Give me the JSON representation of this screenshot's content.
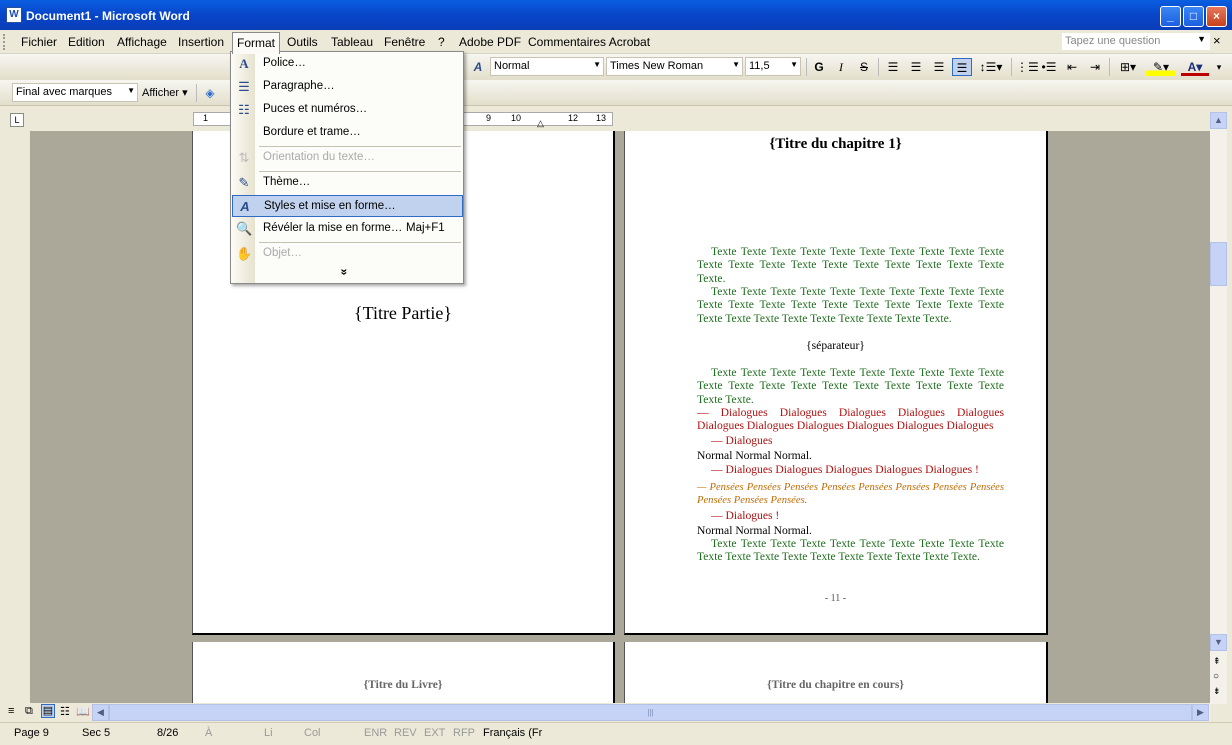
{
  "window": {
    "title": "Document1 - Microsoft Word",
    "app_icon": "W"
  },
  "menubar": {
    "items": [
      "Fichier",
      "Edition",
      "Affichage",
      "Insertion",
      "Format",
      "Outils",
      "Tableau",
      "Fenêtre",
      "?",
      "Adobe PDF",
      "Commentaires Acrobat"
    ],
    "active": "Format",
    "question_placeholder": "Tapez une question"
  },
  "format_menu": {
    "items": [
      {
        "label": "Police…",
        "icon": "font-icon",
        "enabled": true
      },
      {
        "label": "Paragraphe…",
        "icon": "paragraph-icon",
        "enabled": true
      },
      {
        "label": "Puces et numéros…",
        "icon": "bullets-icon",
        "enabled": true
      },
      {
        "label": "Bordure et trame…",
        "icon": "",
        "enabled": true
      },
      {
        "label": "Orientation du texte…",
        "icon": "text-direction-icon",
        "enabled": false
      },
      {
        "label": "Thème…",
        "icon": "theme-icon",
        "enabled": true
      },
      {
        "label": "Styles et mise en forme…",
        "icon": "styles-icon",
        "enabled": true,
        "highlighted": true
      },
      {
        "label": "Révéler la mise en forme…",
        "icon": "reveal-formatting-icon",
        "enabled": true,
        "shortcut": "Maj+F1"
      },
      {
        "label": "Objet…",
        "icon": "object-icon",
        "enabled": false
      }
    ],
    "expand_glyph": "»"
  },
  "toolbar": {
    "style": "Normal",
    "font": "Times New Roman",
    "size": "11,5",
    "bold": "G",
    "italic": "I",
    "strike": "S"
  },
  "reviewing_toolbar": {
    "view_mode": "Final avec marques",
    "show_label": "Afficher"
  },
  "ruler": {
    "numbers": [
      "1",
      "9",
      "10",
      "12",
      "13"
    ]
  },
  "pages": {
    "left_top": {
      "part_title": "{Titre Partie}"
    },
    "right_top": {
      "chapter_title": "{Titre du chapitre 1}",
      "separator": "{séparateur}",
      "page_number": "- 11 -",
      "paragraphs": [
        {
          "style": "green",
          "text": "Texte Texte Texte Texte Texte Texte Texte Texte Texte Texte Texte Texte Texte Texte Texte Texte Texte Texte Texte Texte Texte."
        },
        {
          "style": "green",
          "text": "Texte Texte Texte Texte Texte Texte Texte Texte Texte Texte Texte Texte Texte Texte Texte Texte Texte Texte Texte Texte Texte Texte Texte Texte Texte Texte Texte Texte Texte."
        },
        {
          "style": "green",
          "text": "Texte Texte Texte Texte Texte Texte Texte Texte Texte Texte Texte Texte Texte Texte Texte Texte Texte Texte Texte Texte Texte Texte."
        },
        {
          "style": "red",
          "text": "— Dialogues Dialogues Dialogues Dialogues Dialogues Dialogues Dialogues Dialogues Dialogues Dialogues Dialogues"
        },
        {
          "style": "red",
          "text": "— Dialogues"
        },
        {
          "style": "normal",
          "text": "Normal Normal Normal."
        },
        {
          "style": "red",
          "text": "— Dialogues Dialogues Dialogues Dialogues Dialogues !"
        },
        {
          "style": "orange",
          "text": "— Pensées Pensées Pensées Pensées Pensées Pensées Pensées Pensées Pensées Pensées Pensées."
        },
        {
          "style": "red",
          "text": "— Dialogues !"
        },
        {
          "style": "normal",
          "text": "Normal Normal Normal."
        },
        {
          "style": "green",
          "text": "Texte Texte Texte Texte Texte Texte Texte Texte Texte Texte Texte Texte Texte Texte Texte Texte Texte Texte Texte Texte."
        }
      ]
    },
    "left_bottom": {
      "header": "{Titre du Livre}"
    },
    "right_bottom": {
      "header": "{Titre du chapitre en cours}"
    }
  },
  "statusbar": {
    "page": "Page 9",
    "section": "Sec 5",
    "pages": "8/26",
    "at": "À",
    "line": "Li",
    "col": "Col",
    "modes": [
      "ENR",
      "REV",
      "EXT",
      "RFP"
    ],
    "language": "Français (Fr"
  },
  "colors": {
    "green": "#1f6e1f",
    "red": "#b01010",
    "orange": "#c06a00",
    "highlight": "#c1d2ee"
  }
}
